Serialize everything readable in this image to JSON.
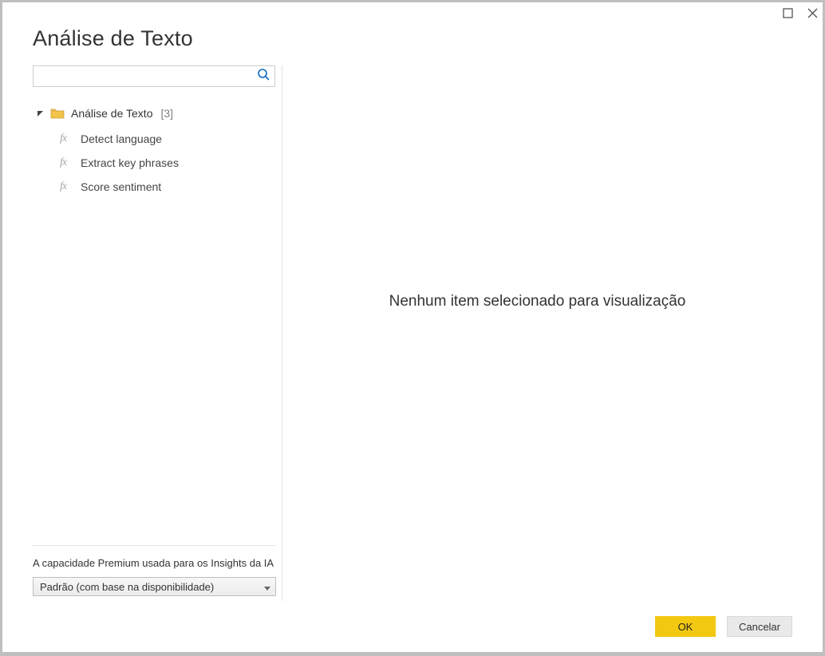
{
  "titlebar": {
    "maximize_icon": "maximize",
    "close_icon": "close"
  },
  "dialog": {
    "title": "Análise de Texto"
  },
  "search": {
    "placeholder": ""
  },
  "tree": {
    "parent": {
      "label": "Análise de Texto",
      "count": "[3]"
    },
    "items": [
      {
        "label": "Detect language"
      },
      {
        "label": "Extract key phrases"
      },
      {
        "label": "Score sentiment"
      }
    ]
  },
  "capacity": {
    "label": "A capacidade Premium usada para os Insights da IA",
    "selected": "Padrão (com base na disponibilidade)"
  },
  "empty": {
    "message": "Nenhum item selecionado para visualização"
  },
  "footer": {
    "ok_label": "OK",
    "cancel_label": "Cancelar"
  }
}
